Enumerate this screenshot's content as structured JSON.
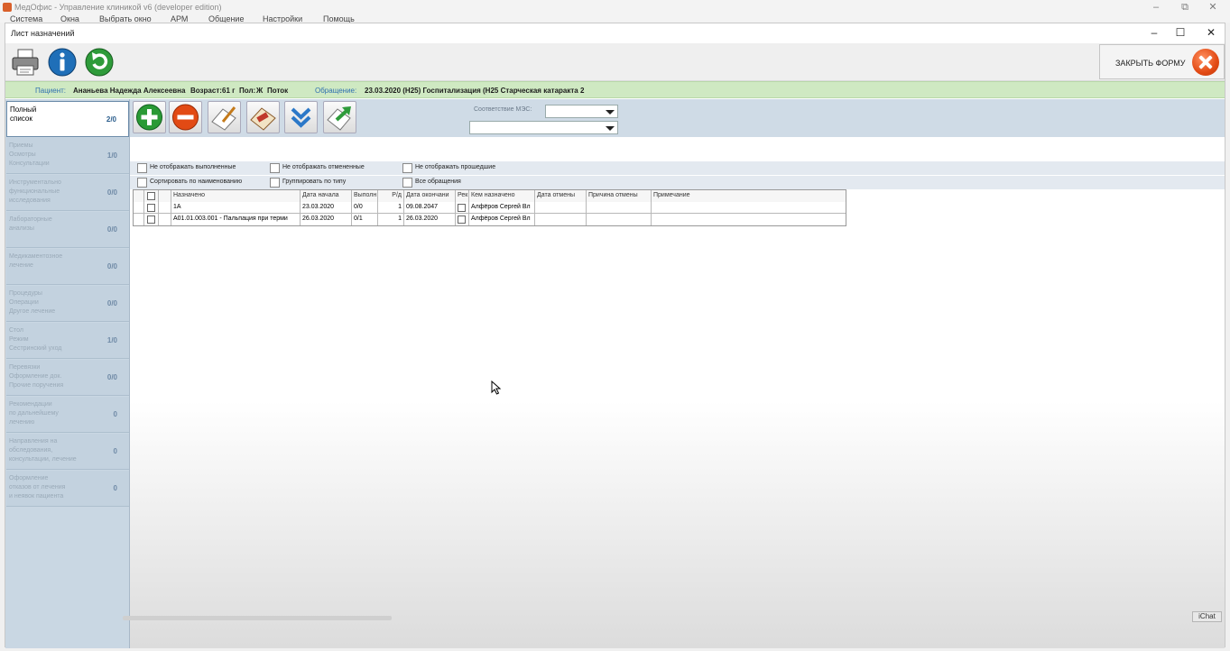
{
  "app": {
    "title": "МедОфис - Управление клиникой v6 (developer edition)",
    "menu": [
      "Система",
      "Окна",
      "Выбрать окно",
      "АРМ",
      "Общение",
      "Настройки",
      "Помощь"
    ]
  },
  "window_controls": {
    "minimize": "–",
    "maximize": "⧉",
    "close": "✕"
  },
  "form": {
    "title": "Лист назначений",
    "close_form_label": "ЗАКРЫТЬ ФОРМУ",
    "controls": {
      "minimize": "–",
      "maximize": "☐",
      "close": "✕"
    }
  },
  "patient": {
    "label": "Пациент:",
    "name": "Ананьева Надежда Алексеевна",
    "age_label": "Возраст:",
    "age": "61 г",
    "sex_label": "Пол:",
    "sex": "Ж",
    "flow": "Поток",
    "appeal_label": "Обращение:",
    "appeal": "23.03.2020 (Н25) Госпитализация (Н25 Старческая катаракта 2"
  },
  "sidebar": {
    "items": [
      {
        "label": "Полный\nсписок",
        "count": "2/0",
        "active": true
      },
      {
        "label": "Приемы\nОсмотры\nКонсультации",
        "count": "1/0"
      },
      {
        "label": "Инструментально\nфункциональные\nисследования",
        "count": "0/0"
      },
      {
        "label": "Лабораторные\nанализы",
        "count": "0/0"
      },
      {
        "label": "Медикаментозное\nлечение",
        "count": "0/0"
      },
      {
        "label": "Процедуры\nОперации\nДругое лечение",
        "count": "0/0"
      },
      {
        "label": "Стол\nРежим\nСестринский уход",
        "count": "1/0"
      },
      {
        "label": "Перевязки\nОформление док.\nПрочие поручения",
        "count": "0/0"
      },
      {
        "label": "Рекомендации\nпо дальнейшему\nлечению",
        "count": "0"
      },
      {
        "label": "Направления на\nобследования,\nконсультации, лечение",
        "count": "0"
      },
      {
        "label": "Оформление\nотказов от лечения\nи неявок пациента",
        "count": "0"
      }
    ]
  },
  "filters": {
    "mes_label": "Соответствие МЭС:",
    "mes_value": "",
    "second_value": "",
    "row1": [
      "Не отображать выполненные",
      "Не отображать отмененные",
      "Не отображать прошедшие"
    ],
    "row2": [
      "Сортировать по наименованию",
      "Группировать по типу",
      "Все обращения"
    ]
  },
  "table": {
    "headers": [
      "Назначено",
      "Дата начала",
      "Выполн",
      "Р/д",
      "Дата окончани",
      "Рек",
      "Кем назначено",
      "Дата отмены",
      "Причина отмены",
      "Примечание"
    ],
    "rows": [
      {
        "name": "1А",
        "start": "23.03.2020",
        "done": "0/0",
        "rd": "1",
        "end": "09.08.2047",
        "by": "Алфёров Сергей Вл",
        "cancel_date": "",
        "cancel_reason": "",
        "note": ""
      },
      {
        "name": "А01.01.003.001 - Пальпация при терми",
        "start": "26.03.2020",
        "done": "0/1",
        "rd": "1",
        "end": "26.03.2020",
        "by": "Алфёров Сергей Вл",
        "cancel_date": "",
        "cancel_reason": "",
        "note": ""
      }
    ]
  },
  "status": {
    "chat": "iChat"
  }
}
